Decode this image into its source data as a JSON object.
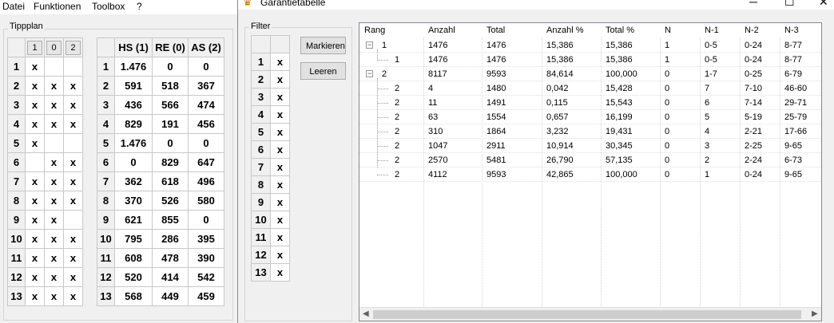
{
  "menu": [
    "Datei",
    "Funktionen",
    "Toolbox",
    "?"
  ],
  "tippplan": {
    "title": "Tippplan",
    "headers": [
      "1",
      "0",
      "2"
    ],
    "rows": [
      {
        "n": "1",
        "c": [
          "x",
          "",
          ""
        ]
      },
      {
        "n": "2",
        "c": [
          "x",
          "x",
          "x"
        ]
      },
      {
        "n": "3",
        "c": [
          "x",
          "x",
          "x"
        ]
      },
      {
        "n": "4",
        "c": [
          "x",
          "x",
          "x"
        ]
      },
      {
        "n": "5",
        "c": [
          "x",
          "",
          ""
        ]
      },
      {
        "n": "6",
        "c": [
          "",
          "x",
          "x"
        ]
      },
      {
        "n": "7",
        "c": [
          "x",
          "x",
          "x"
        ]
      },
      {
        "n": "8",
        "c": [
          "x",
          "x",
          "x"
        ]
      },
      {
        "n": "9",
        "c": [
          "x",
          "x",
          ""
        ]
      },
      {
        "n": "10",
        "c": [
          "x",
          "x",
          "x"
        ]
      },
      {
        "n": "11",
        "c": [
          "x",
          "x",
          "x"
        ]
      },
      {
        "n": "12",
        "c": [
          "x",
          "x",
          "x"
        ]
      },
      {
        "n": "13",
        "c": [
          "x",
          "x",
          "x"
        ]
      }
    ]
  },
  "stats": {
    "headers": [
      "HS (1)",
      "RE (0)",
      "AS (2)"
    ],
    "rows": [
      {
        "n": "1",
        "c": [
          "1.476",
          "0",
          "0"
        ]
      },
      {
        "n": "2",
        "c": [
          "591",
          "518",
          "367"
        ]
      },
      {
        "n": "3",
        "c": [
          "436",
          "566",
          "474"
        ]
      },
      {
        "n": "4",
        "c": [
          "829",
          "191",
          "456"
        ]
      },
      {
        "n": "5",
        "c": [
          "1.476",
          "0",
          "0"
        ]
      },
      {
        "n": "6",
        "c": [
          "0",
          "829",
          "647"
        ]
      },
      {
        "n": "7",
        "c": [
          "362",
          "618",
          "496"
        ]
      },
      {
        "n": "8",
        "c": [
          "370",
          "526",
          "580"
        ]
      },
      {
        "n": "9",
        "c": [
          "621",
          "855",
          "0"
        ]
      },
      {
        "n": "10",
        "c": [
          "795",
          "286",
          "395"
        ]
      },
      {
        "n": "11",
        "c": [
          "608",
          "478",
          "390"
        ]
      },
      {
        "n": "12",
        "c": [
          "520",
          "414",
          "542"
        ]
      },
      {
        "n": "13",
        "c": [
          "568",
          "449",
          "459"
        ]
      }
    ]
  },
  "garantie": {
    "title": "Garantietabelle",
    "filter_title": "Filter",
    "filter_rows": [
      {
        "n": "1",
        "v": "x"
      },
      {
        "n": "2",
        "v": "x"
      },
      {
        "n": "3",
        "v": "x"
      },
      {
        "n": "4",
        "v": "x"
      },
      {
        "n": "5",
        "v": "x"
      },
      {
        "n": "6",
        "v": "x"
      },
      {
        "n": "7",
        "v": "x"
      },
      {
        "n": "8",
        "v": "x"
      },
      {
        "n": "9",
        "v": "x"
      },
      {
        "n": "10",
        "v": "x"
      },
      {
        "n": "11",
        "v": "x"
      },
      {
        "n": "12",
        "v": "x"
      },
      {
        "n": "13",
        "v": "x"
      }
    ],
    "buttons": {
      "mark": "Markieren",
      "clear": "Leeren"
    },
    "columns": [
      "Rang",
      "Anzahl",
      "Total",
      "Anzahl %",
      "Total %",
      "N",
      "N-1",
      "N-2",
      "N-3"
    ],
    "rows": [
      {
        "level": 0,
        "exp": "−",
        "c": [
          "1",
          "1476",
          "1476",
          "15,386",
          "15,386",
          "1",
          "0-5",
          "0-24",
          "8-77"
        ]
      },
      {
        "level": 1,
        "exp": "",
        "c": [
          "1",
          "1476",
          "1476",
          "15,386",
          "15,386",
          "1",
          "0-5",
          "0-24",
          "8-77"
        ]
      },
      {
        "level": 0,
        "exp": "−",
        "c": [
          "2",
          "8117",
          "9593",
          "84,614",
          "100,000",
          "0",
          "1-7",
          "0-25",
          "6-79"
        ]
      },
      {
        "level": 1,
        "exp": "",
        "c": [
          "2",
          "4",
          "1480",
          "0,042",
          "15,428",
          "0",
          "7",
          "7-10",
          "46-60"
        ]
      },
      {
        "level": 1,
        "exp": "",
        "c": [
          "2",
          "11",
          "1491",
          "0,115",
          "15,543",
          "0",
          "6",
          "7-14",
          "29-71"
        ]
      },
      {
        "level": 1,
        "exp": "",
        "c": [
          "2",
          "63",
          "1554",
          "0,657",
          "16,199",
          "0",
          "5",
          "5-19",
          "25-79"
        ]
      },
      {
        "level": 1,
        "exp": "",
        "c": [
          "2",
          "310",
          "1864",
          "3,232",
          "19,431",
          "0",
          "4",
          "2-21",
          "17-66"
        ]
      },
      {
        "level": 1,
        "exp": "",
        "c": [
          "2",
          "1047",
          "2911",
          "10,914",
          "30,345",
          "0",
          "3",
          "2-25",
          "9-65"
        ]
      },
      {
        "level": 1,
        "exp": "",
        "c": [
          "2",
          "2570",
          "5481",
          "26,790",
          "57,135",
          "0",
          "2",
          "2-24",
          "6-73"
        ]
      },
      {
        "level": 1,
        "exp": "",
        "c": [
          "2",
          "4112",
          "9593",
          "42,865",
          "100,000",
          "0",
          "1",
          "0-24",
          "9-65"
        ]
      }
    ]
  },
  "window_controls": {
    "minimize": "─",
    "maximize": "☐",
    "close": "✕"
  },
  "scroll_arrows": {
    "left": "◀",
    "right": "▶"
  },
  "icons": {
    "app": "app-icon",
    "expander": "minus-expander-icon"
  }
}
